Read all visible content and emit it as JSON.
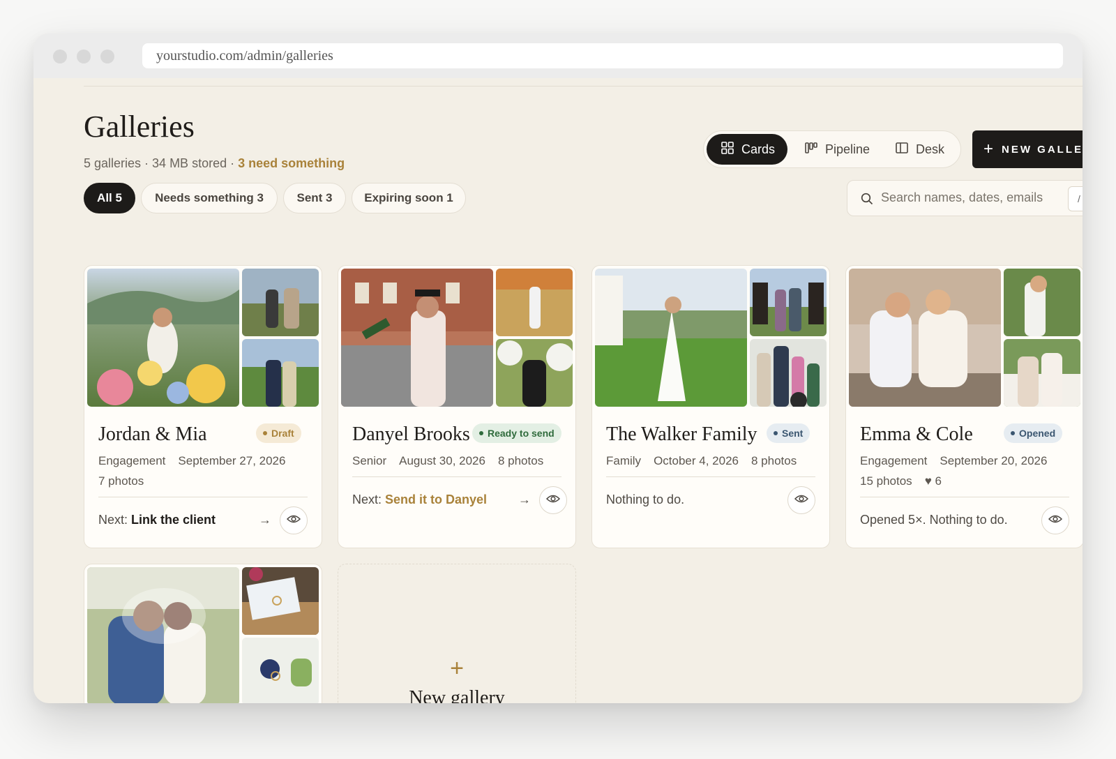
{
  "browser": {
    "url": "yourstudio.com/admin/galleries"
  },
  "header": {
    "title": "Galleries",
    "subtitle_stats": "5 galleries · 34 MB stored · ",
    "subtitle_accent": "3 need something"
  },
  "views": {
    "cards": "Cards",
    "pipeline": "Pipeline",
    "desk": "Desk",
    "active": "Cards"
  },
  "new_button": "NEW GALLERY",
  "filters": [
    {
      "label": "All 5",
      "active": true
    },
    {
      "label": "Needs something 3",
      "active": false
    },
    {
      "label": "Sent 3",
      "active": false
    },
    {
      "label": "Expiring soon 1",
      "active": false
    }
  ],
  "search": {
    "placeholder": "Search names, dates, emails",
    "shortcut": "/"
  },
  "galleries": [
    {
      "name": "Jordan & Mia",
      "status": "Draft",
      "type": "Engagement",
      "date": "September 27, 2026",
      "photos": "7 photos",
      "next_label": "Next:",
      "next_action": "Link the client"
    },
    {
      "name": "Danyel Brooks",
      "status": "Ready to send",
      "type": "Senior",
      "date": "August 30, 2026",
      "photos": "8 photos",
      "next_label": "Next:",
      "next_action": "Send it to Danyel"
    },
    {
      "name": "The Walker Family",
      "status": "Sent",
      "type": "Family",
      "date": "October 4, 2026",
      "photos": "8 photos",
      "footer_text": "Nothing to do."
    },
    {
      "name": "Emma & Cole",
      "status": "Opened",
      "type": "Engagement",
      "date": "September 20, 2026",
      "photos": "15 photos",
      "favorites": "♥ 6",
      "footer_text": "Opened 5×. Nothing to do."
    }
  ],
  "new_gallery_card": {
    "icon": "+",
    "label": "New gallery"
  },
  "colors": {
    "accent_gold": "#a9823a",
    "dark": "#1d1b19",
    "background": "#f3efe6",
    "draft_bg": "#f5ead6",
    "ready_bg": "#e3efe4",
    "sent_bg": "#e6ecf1"
  }
}
